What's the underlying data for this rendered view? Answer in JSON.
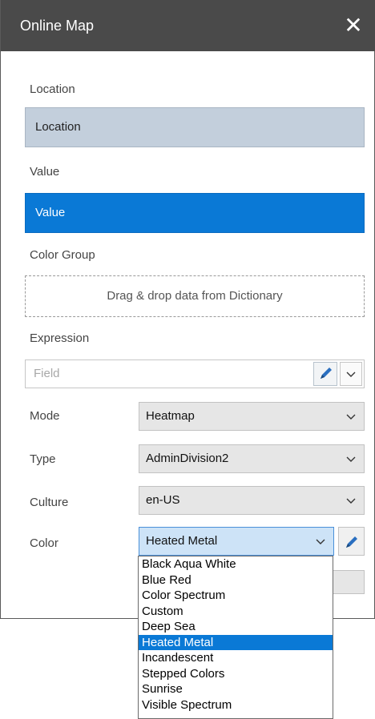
{
  "window": {
    "title": "Online Map",
    "close_label": "✕"
  },
  "location": {
    "label": "Location",
    "value": "Location"
  },
  "value": {
    "label": "Value",
    "value": "Value"
  },
  "color_group": {
    "label": "Color Group",
    "placeholder": "Drag & drop data from Dictionary"
  },
  "expression": {
    "label": "Expression",
    "placeholder": "Field"
  },
  "mode": {
    "label": "Mode",
    "value": "Heatmap"
  },
  "type": {
    "label": "Type",
    "value": "AdminDivision2"
  },
  "culture": {
    "label": "Culture",
    "value": "en-US"
  },
  "color": {
    "label": "Color",
    "value": "Heated Metal",
    "options": [
      "Black Aqua White",
      "Blue Red",
      "Color Spectrum",
      "Custom",
      "Deep Sea",
      "Heated Metal",
      "Incandescent",
      "Stepped Colors",
      "Sunrise",
      "Visible Spectrum"
    ],
    "selected_index": 5
  },
  "colors": {
    "titlebar": "#4a4a4a",
    "selected_blue": "#0a79d6",
    "location_bg": "#c3cfdc"
  }
}
